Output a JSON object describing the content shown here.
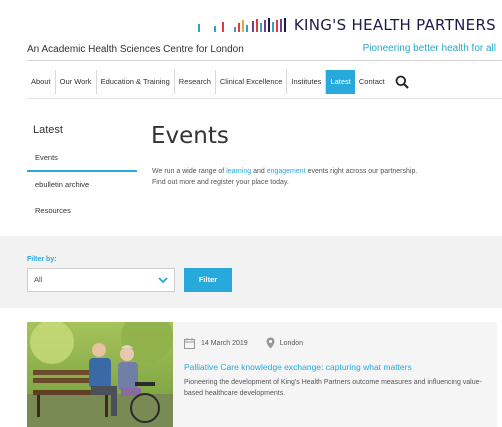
{
  "header": {
    "brand_name": "KING'S HEALTH PARTNERS",
    "tagline_left": "An Academic Health Sciences Centre for London",
    "tagline_right": "Pioneering better health for all",
    "logo_bar_colors": [
      "#2ea3c6",
      "#2ea3c6",
      "#e23a3a",
      "#2ea3c6",
      "#e23a3a",
      "#f2a13b",
      "#2ea3c6",
      "#7a3b8f",
      "#e23a3a",
      "#2ea3c6",
      "#7a3b8f",
      "#1b1b4b",
      "#2ea3c6",
      "#e23a3a",
      "#7a3b8f",
      "#1b1b4b"
    ]
  },
  "nav": {
    "items": [
      "About",
      "Our Work",
      "Education & Training",
      "Research",
      "Clinical Excellence",
      "Institutes",
      "Latest",
      "Contact"
    ],
    "active": "Latest",
    "search_icon": "search-icon"
  },
  "sidebar": {
    "title": "Latest",
    "items": [
      "Events",
      "ebulletin archive",
      "Resources"
    ],
    "active": "Events"
  },
  "main": {
    "title": "Events",
    "intro_part1": "We run a wide range of ",
    "intro_link1": "learning",
    "intro_part2": " and ",
    "intro_link2": "engagement",
    "intro_part3": " events right across our partnership.",
    "intro_line2": "Find out more and register your place today."
  },
  "filter": {
    "label": "Filter by:",
    "selected": "All",
    "button": "Filter"
  },
  "event": {
    "date": "14 March 2019",
    "location": "London",
    "title": "Palliative Care knowledge exchange: capturing what matters",
    "description": "Pioneering the development of King's Health Partners outcome measures and influencing value-based healthcare developments."
  },
  "colors": {
    "accent": "#27a9dc",
    "brand_navy": "#1b1b4b"
  }
}
